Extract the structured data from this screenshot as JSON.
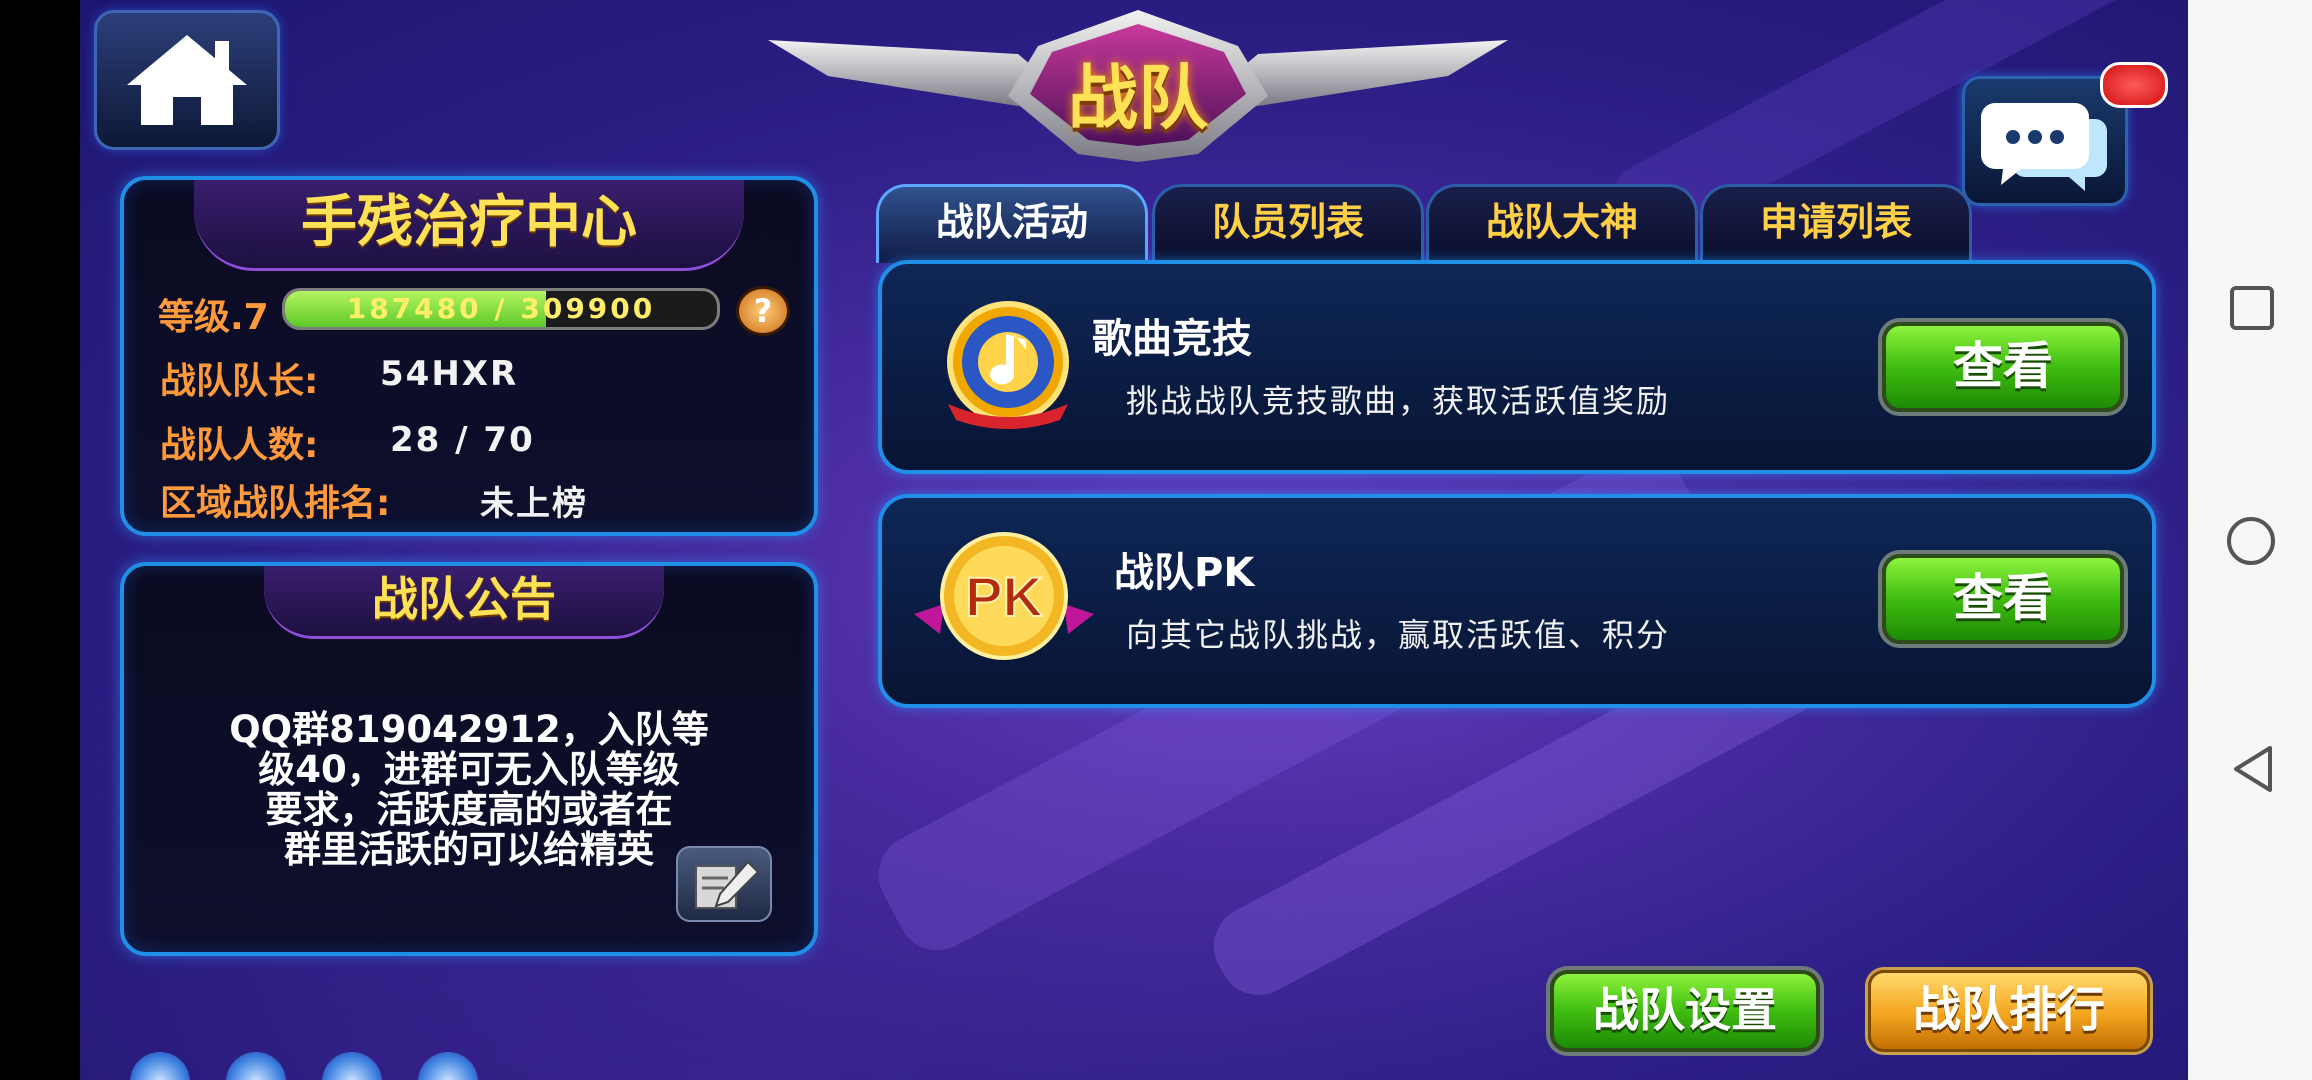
{
  "header": {
    "title": "战队"
  },
  "team": {
    "name": "手残治疗中心",
    "level_label": "等级.7",
    "xp_text": "187480 / 309900",
    "xp_fraction": 0.605,
    "help_glyph": "?",
    "captain_label": "战队队长:",
    "captain_value": "54HXR",
    "members_label": "战队人数:",
    "members_value": "28 / 70",
    "rank_label": "区域战队排名:",
    "rank_value": "未上榜"
  },
  "notice": {
    "title": "战队公告",
    "lines": [
      "QQ群819042912，入队等",
      "级40，进群可无入队等级",
      "要求，活跃度高的或者在",
      "群里活跃的可以给精英"
    ]
  },
  "tabs": [
    {
      "label": "战队活动",
      "active": true
    },
    {
      "label": "队员列表",
      "active": false
    },
    {
      "label": "战队大神",
      "active": false
    },
    {
      "label": "申请列表",
      "active": false
    }
  ],
  "activities": [
    {
      "title": "歌曲竞技",
      "desc": "挑战战队竞技歌曲，获取活跃值奖励",
      "button": "查看",
      "icon": "music-note-icon"
    },
    {
      "title": "战队PK",
      "desc": "向其它战队挑战，赢取活跃值、积分",
      "button": "查看",
      "icon": "pk-badge-icon",
      "badge_text": "PK"
    }
  ],
  "footer": {
    "settings_button": "战队设置",
    "ranking_button": "战队排行"
  },
  "colors": {
    "accent_blue": "#1f8fe8",
    "gold": "#ffe155",
    "orange_label": "#ff9a3c",
    "green_button": "#3fbd10"
  }
}
